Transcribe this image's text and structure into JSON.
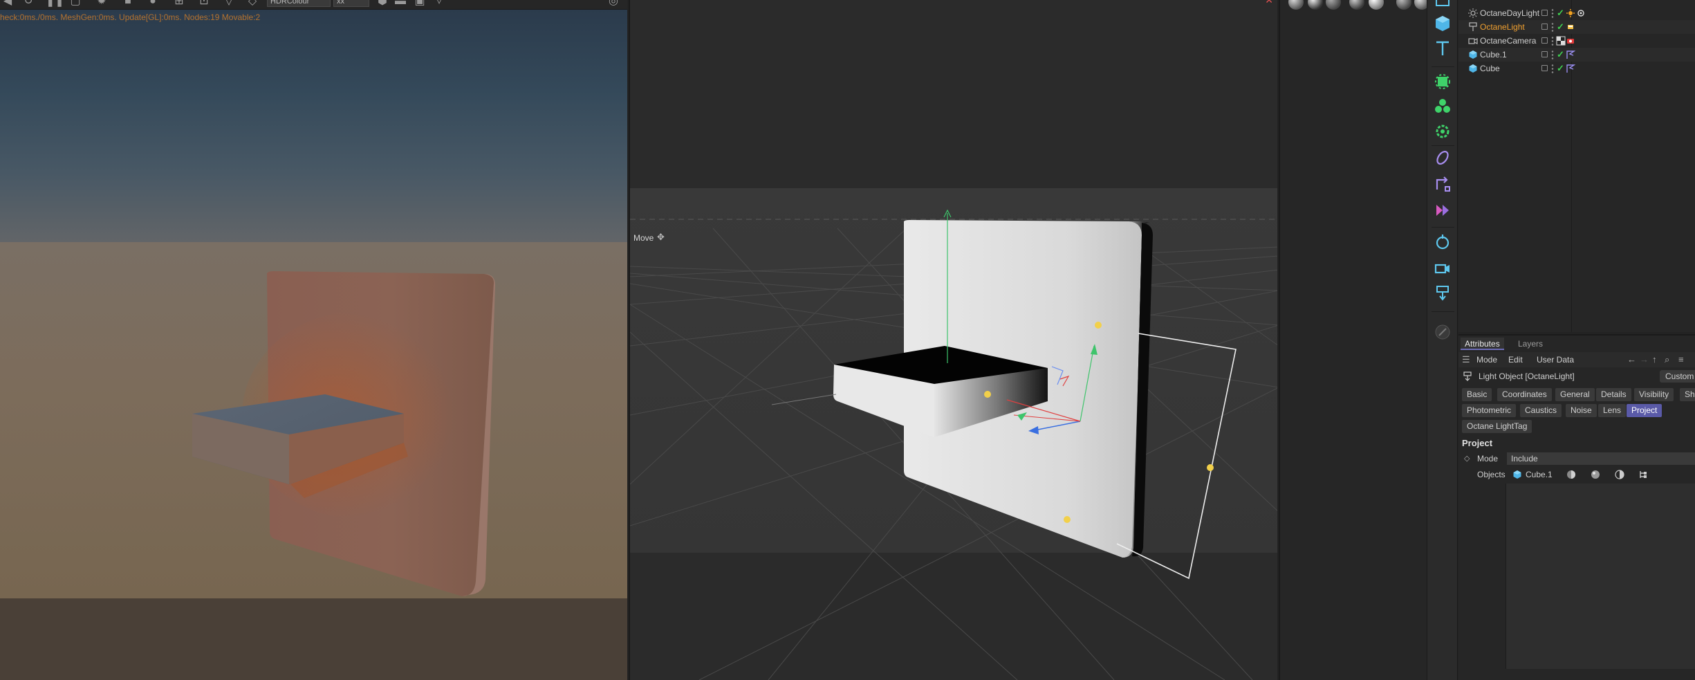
{
  "octane": {
    "stats": "heck:0ms./0ms. MeshGen:0ms. Update[GL]:0ms. Nodes:19 Movable:2",
    "toolbar_select_1": "HDRColour",
    "toolbar_select_2": "xx"
  },
  "viewport": {
    "mode_label": "Move"
  },
  "object_manager": {
    "objects": [
      {
        "name": "OctaneDayLight",
        "active": false
      },
      {
        "name": "OctaneLight",
        "active": true
      },
      {
        "name": "OctaneCamera",
        "active": false
      },
      {
        "name": "Cube.1",
        "active": false
      },
      {
        "name": "Cube",
        "active": false
      }
    ]
  },
  "attributes": {
    "tabs": [
      "Attributes",
      "Layers"
    ],
    "menu": [
      "Mode",
      "Edit",
      "User Data"
    ],
    "object_title": "Light Object [OctaneLight]",
    "custom_button": "Custom",
    "prop_tabs_row1": [
      "Basic",
      "Coordinates",
      "General",
      "Details",
      "Visibility",
      "Sha"
    ],
    "prop_tabs_row2": [
      "Photometric",
      "Caustics",
      "Noise",
      "Lens",
      "Project"
    ],
    "prop_tabs_row3": [
      "Octane LightTag"
    ],
    "active_tab": "Project",
    "section_title": "Project",
    "mode_label": "Mode",
    "mode_value": "Include",
    "objects_label": "Objects",
    "objects_item": "Cube.1"
  },
  "colors": {
    "accent": "#5a5aa8",
    "active_object": "#f0a030",
    "check_green": "#3fcf50",
    "stats_orange": "#b4722f"
  }
}
